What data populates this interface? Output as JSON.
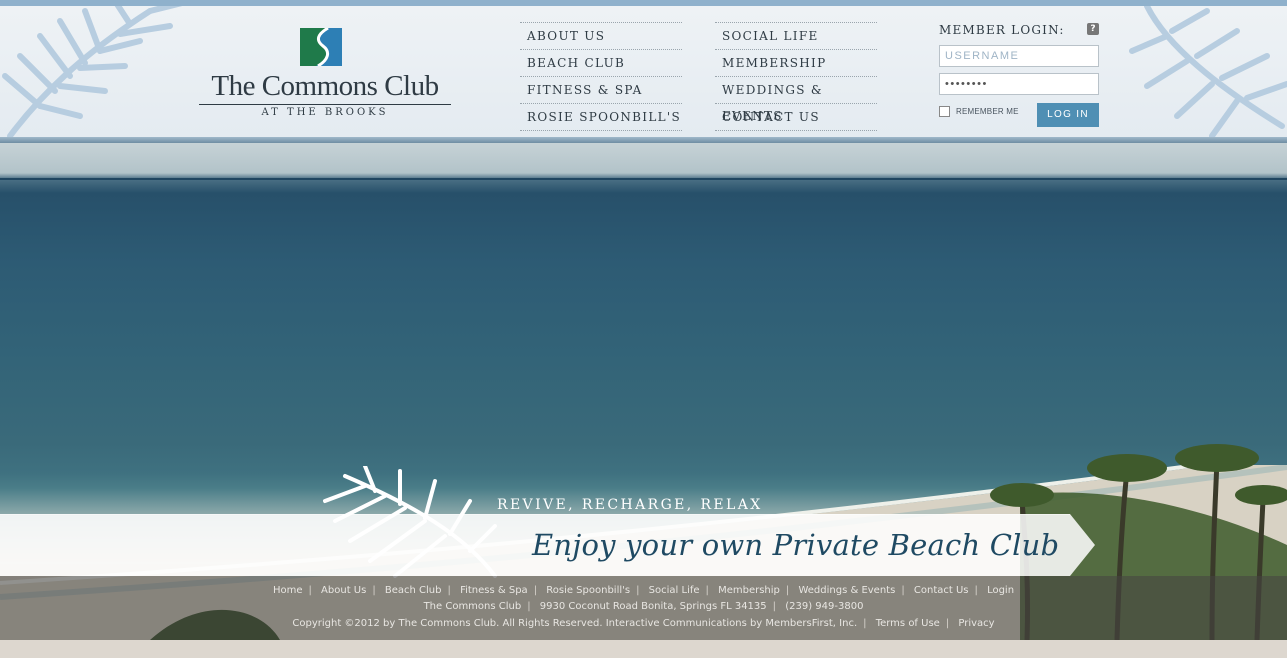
{
  "brand": {
    "title": "The Commons Club",
    "subtitle": "AT THE BROOKS"
  },
  "nav": {
    "col1": [
      "ABOUT US",
      "BEACH CLUB",
      "FITNESS & SPA",
      "ROSIE SPOONBILL'S"
    ],
    "col2": [
      "SOCIAL LIFE",
      "MEMBERSHIP",
      "WEDDINGS & EVENTS",
      "CONTACT US"
    ]
  },
  "login": {
    "title": "MEMBER LOGIN:",
    "help": "?",
    "username_placeholder": "USERNAME",
    "password_value": "password",
    "remember_label": "REMEMBER ME",
    "button": "LOG IN"
  },
  "hero": {
    "tagline_small": "REVIVE, RECHARGE, RELAX",
    "tagline_main": "Enjoy your own Private Beach Club"
  },
  "footer": {
    "links": [
      "Home",
      "About Us",
      "Beach Club",
      "Fitness & Spa",
      "Rosie Spoonbill's",
      "Social Life",
      "Membership",
      "Weddings & Events",
      "Contact Us",
      "Login"
    ],
    "address": [
      "The Commons Club",
      "9930 Coconut Road Bonita, Springs FL 34135",
      "(239) 949-3800"
    ],
    "copyright": "Copyright ©2012 by The Commons Club. All Rights Reserved. Interactive Communications by MembersFirst, Inc.",
    "terms": "Terms of Use",
    "privacy": "Privacy"
  },
  "colors": {
    "accent": "#4f8fb4",
    "text": "#2f3b44",
    "headline": "#1f4a63",
    "logo_green": "#1f7a4a",
    "logo_blue": "#2d7fb5"
  }
}
